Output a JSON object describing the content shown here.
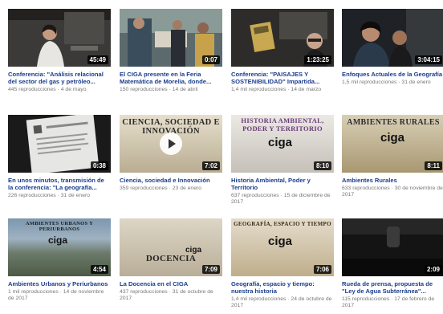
{
  "videos": [
    {
      "title": "Conferencia: \"Análisis relacional del sector del gas y petróleo...",
      "meta": "445 reproducciones · 4 de mayo",
      "duration": "45:49",
      "icon": "video-thumbnail"
    },
    {
      "title": "El CIGA presente en la Feria Matemática de Morelia, donde...",
      "meta": "150 reproducciones · 14 de abril",
      "duration": "0:07",
      "icon": "video-thumbnail"
    },
    {
      "title": "Conferencia: \"PAISAJES Y SOSTENIBILIDAD\" Impartida...",
      "meta": "1,4 mil reproducciones · 14 de marzo",
      "duration": "1:23:25",
      "icon": "video-thumbnail"
    },
    {
      "title": "Enfoques Actuales de la Geografía",
      "meta": "1,5 mil reproducciones · 31 de enero",
      "duration": "3:04:15",
      "icon": "video-thumbnail"
    },
    {
      "title": "En unos minutos, transmisión de la conferencia: \"La geografía...",
      "meta": "226 reproducciones · 31 de enero",
      "duration": "0:38",
      "icon": "video-thumbnail"
    },
    {
      "title": "Ciencia, sociedad e Innovación",
      "meta": "359 reproducciones · 23 de enero",
      "duration": "7:02",
      "icon": "video-thumbnail",
      "poster": "CIENCIA, SOCIEDAD E INNOVACIÓN"
    },
    {
      "title": "Historia Ambiental, Poder y Territorio",
      "meta": "637 reproducciones · 15 de diciembre de 2017",
      "duration": "8:10",
      "icon": "video-thumbnail",
      "poster": "HISTORIA AMBIENTAL, PODER Y TERRITORIO"
    },
    {
      "title": "Ambientes Rurales",
      "meta": "633 reproducciones · 30 de noviembre de 2017",
      "duration": "8:11",
      "icon": "video-thumbnail",
      "poster": "AMBIENTES RURALES"
    },
    {
      "title": "Ambientes Urbanos y Periurbanos",
      "meta": "1 mil reproducciones · 14 de noviembre de 2017",
      "duration": "4:54",
      "icon": "video-thumbnail",
      "poster": "AMBIENTES URBANOS Y PERIURBANOS"
    },
    {
      "title": "La Docencia en el CIGA",
      "meta": "437 reproducciones · 31 de octubre de 2017",
      "duration": "7:09",
      "icon": "video-thumbnail",
      "poster": "DOCENCIA"
    },
    {
      "title": "Geografía, espacio y tiempo: nuestra historia",
      "meta": "1,4 mil reproducciones · 24 de octubre de 2017",
      "duration": "7:06",
      "icon": "video-thumbnail",
      "poster": "GEOGRAFÍA, ESPACIO Y TIEMPO"
    },
    {
      "title": "Rueda de prensa, propuesta de \"Ley de Agua Subterránea\"...",
      "meta": "115 reproducciones · 17 de febrero de 2017",
      "duration": "2:09",
      "icon": "video-thumbnail"
    }
  ],
  "logo_text": "ciga",
  "colors": {
    "title": "#1a3d8c",
    "meta": "#777777",
    "duration_bg": "#000000"
  }
}
